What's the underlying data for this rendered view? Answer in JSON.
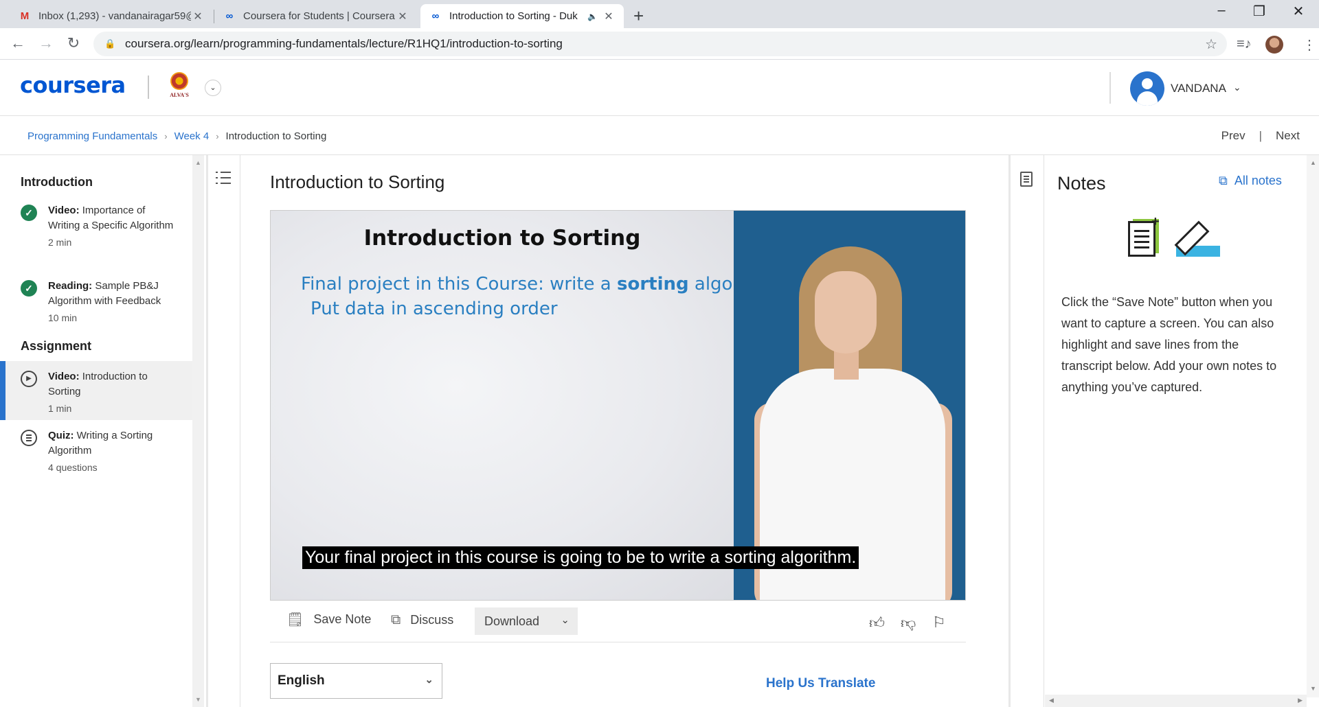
{
  "browser": {
    "tabs": [
      {
        "title": "Inbox (1,293) - vandanairagar59@",
        "favicon": "gmail-icon"
      },
      {
        "title": "Coursera for Students | Coursera",
        "favicon": "coursera-icon"
      },
      {
        "title": "Introduction to Sorting - Duk",
        "favicon": "coursera-icon",
        "active": true
      }
    ],
    "url": "coursera.org/learn/programming-fundamentals/lecture/R1HQ1/introduction-to-sorting"
  },
  "header": {
    "logo": "coursera",
    "institution_label": "ALVA'S",
    "username": "VANDANA"
  },
  "breadcrumb": {
    "items": [
      "Programming Fundamentals",
      "Week 4"
    ],
    "current": "Introduction to Sorting"
  },
  "nav": {
    "prev": "Prev",
    "next": "Next"
  },
  "sidebar": {
    "sections": [
      {
        "title": "Introduction",
        "items": [
          {
            "type": "Video:",
            "title": "Importance of Writing a Specific Algorithm",
            "meta": "2 min",
            "status": "completed"
          },
          {
            "type": "Reading:",
            "title": "Sample PB&J Algorithm with Feedback",
            "meta": "10 min",
            "status": "completed"
          }
        ]
      },
      {
        "title": "Assignment",
        "items": [
          {
            "type": "Video:",
            "title": "Introduction to Sorting",
            "meta": "1 min",
            "status": "current"
          },
          {
            "type": "Quiz:",
            "title": "Writing a Sorting Algorithm",
            "meta": "4 questions",
            "status": "not-started"
          }
        ]
      }
    ]
  },
  "main": {
    "title": "Introduction to Sorting",
    "video": {
      "slide_title": "Introduction to Sorting",
      "slide_line1_pre": "Final project in this Course: write a ",
      "slide_line1_bold": "sorting",
      "slide_line1_post": " algorithm",
      "slide_line2": "Put data in ascending order",
      "caption": "Your final project in this course is going to be to write a sorting algorithm."
    },
    "actions": {
      "save_note": "Save Note",
      "discuss": "Discuss",
      "download": "Download"
    },
    "language": "English",
    "help_translate": "Help Us Translate"
  },
  "notes": {
    "title": "Notes",
    "all_notes": "All notes",
    "description": "Click the “Save Note” button when you want to capture a screen. You can also highlight and save lines from the transcript below. Add your own notes to anything you’ve captured."
  },
  "colors": {
    "brand": "#0056d2",
    "link": "#2a73cc",
    "completed": "#1f8354",
    "presenter_bg": "#1f5f8f"
  }
}
